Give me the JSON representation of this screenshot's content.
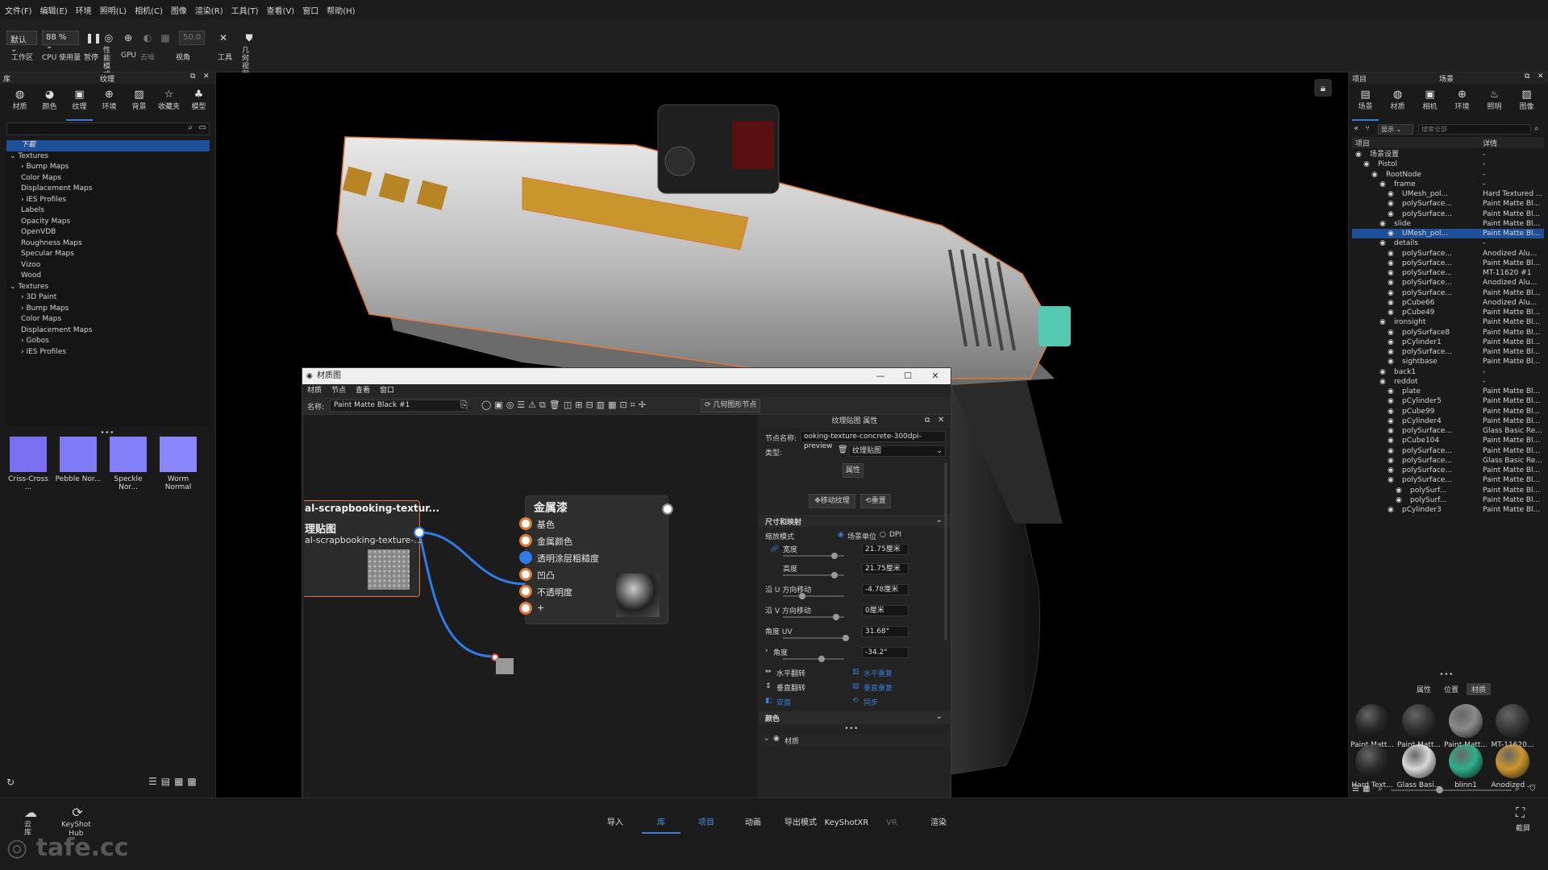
{
  "menu": [
    "文件(F)",
    "编辑(E)",
    "环境",
    "照明(L)",
    "相机(C)",
    "图像",
    "渲染(R)",
    "工具(T)",
    "查看(V)",
    "窗口",
    "帮助(H)"
  ],
  "toolbar": {
    "workspace_value": "默认",
    "workspace_label": "工作区",
    "cpu_value": "88 %",
    "cpu_label": "CPU 使用量",
    "pause_label": "暂停",
    "perf_label": "性能\n模式",
    "gpu_label": "GPU",
    "denoise_label": "去噪",
    "camera_value": "50.0",
    "view_label": "视角",
    "tools_label": "工具",
    "geo_label": "几何\n视图"
  },
  "left": {
    "header_left": "库",
    "header_title": "纹理",
    "tabs": [
      "材质",
      "颜色",
      "纹理",
      "环境",
      "背景",
      "收藏夹",
      "模型"
    ],
    "tree": [
      {
        "label": "下载",
        "depth": 1,
        "sel": true
      },
      {
        "label": "Textures",
        "depth": 0,
        "caret": "⌄"
      },
      {
        "label": "Bump Maps",
        "depth": 1,
        "caret": "›"
      },
      {
        "label": "Color Maps",
        "depth": 1
      },
      {
        "label": "Displacement Maps",
        "depth": 1
      },
      {
        "label": "IES Profiles",
        "depth": 1,
        "caret": "›"
      },
      {
        "label": "Labels",
        "depth": 1
      },
      {
        "label": "Opacity Maps",
        "depth": 1
      },
      {
        "label": "OpenVDB",
        "depth": 1
      },
      {
        "label": "Roughness Maps",
        "depth": 1
      },
      {
        "label": "Specular Maps",
        "depth": 1
      },
      {
        "label": "Vizoo",
        "depth": 1
      },
      {
        "label": "Wood",
        "depth": 1
      },
      {
        "label": "Textures",
        "depth": 0,
        "caret": "⌄"
      },
      {
        "label": "3D Paint",
        "depth": 1,
        "caret": "›"
      },
      {
        "label": "Bump Maps",
        "depth": 1,
        "caret": "›"
      },
      {
        "label": "Color Maps",
        "depth": 1
      },
      {
        "label": "Displacement Maps",
        "depth": 1
      },
      {
        "label": "Gobos",
        "depth": 1,
        "caret": "›"
      },
      {
        "label": "IES Profiles",
        "depth": 1,
        "caret": "›"
      }
    ],
    "thumbs": [
      {
        "label": "Criss-Cross ...",
        "color": "#7a6ff0"
      },
      {
        "label": "Pebble Nor...",
        "color": "#7f7bf6"
      },
      {
        "label": "Speckle Nor...",
        "color": "#8480fa"
      },
      {
        "label": "Worm Normal",
        "color": "#8a86fb"
      }
    ]
  },
  "material_editor": {
    "title": "材质图",
    "menu": [
      "材质",
      "节点",
      "查看",
      "窗口"
    ],
    "name_label": "名称:",
    "name_value": "Paint Matte Black #1",
    "geo_node_btn": "几何图形节点",
    "texture_node_title": "al-scrapbooking-textur...",
    "texture_node_sub": "理贴图",
    "texture_node_file": "al-scrapbooking-texture-...",
    "metal_node_title": "金属漆",
    "metal_inputs": [
      "基色",
      "金属颜色",
      "透明涂层粗糙度",
      "凹凸",
      "不透明度",
      "+"
    ],
    "props": {
      "title": "纹理贴图 属性",
      "node_name_label": "节点名称:",
      "node_name_value": "ooking-texture-concrete-300dpi-preview",
      "type_label": "类型:",
      "type_value": "纹理贴图",
      "tab_props": "属性",
      "move_texture": "移动纹理",
      "reset": "重置",
      "section_size": "尺寸和映射",
      "scale_mode_label": "缩放模式",
      "scale_mode_scene": "场景单位",
      "scale_mode_dpi": "DPI",
      "width_label": "宽度",
      "width_value": "21.75厘米",
      "height_label": "高度",
      "height_value": "21.75厘米",
      "u_move_label": "沿 U 方向移动",
      "u_move_value": "-4.78厘米",
      "v_move_label": "沿 V 方向移动",
      "v_move_value": "0厘米",
      "angle_uv_label": "角度 UV",
      "angle_uv_value": "31.68°",
      "angle_label": "角度",
      "angle_value": "-34.2°",
      "flip_h_label": "水平翻转",
      "repeat_h_label": "水平重复",
      "flip_v_label": "垂直翻转",
      "repeat_v_label": "垂直重复",
      "mirror_label": "双面",
      "sync_label": "同步",
      "section_color": "颜色",
      "section_material": "材质"
    }
  },
  "right": {
    "header_left": "项目",
    "header_title": "场景",
    "tabs": [
      "场景",
      "材质",
      "相机",
      "环境",
      "照明",
      "图像"
    ],
    "show_value": "显示",
    "search_placeholder": "搜索全部",
    "col_item": "项目",
    "col_detail": "详情",
    "tree": [
      {
        "name": "场景设置",
        "detail": "-",
        "indent": 0
      },
      {
        "name": "Pistol",
        "detail": "-",
        "indent": 1
      },
      {
        "name": "RootNode",
        "detail": "-",
        "indent": 2
      },
      {
        "name": "frame",
        "detail": "-",
        "indent": 3
      },
      {
        "name": "UMesh_pol...",
        "detail": "Hard Textured ...",
        "indent": 4
      },
      {
        "name": "polySurface...",
        "detail": "Paint Matte Bl...",
        "indent": 4
      },
      {
        "name": "polySurface...",
        "detail": "Paint Matte Bl...",
        "indent": 4
      },
      {
        "name": "slide",
        "detail": "Paint Matte Bl...",
        "indent": 3
      },
      {
        "name": "UMesh_pol...",
        "detail": "Paint Matte Bl...",
        "indent": 4,
        "sel": true
      },
      {
        "name": "details",
        "detail": "-",
        "indent": 3
      },
      {
        "name": "polySurface...",
        "detail": "Anodized Alu...",
        "indent": 4
      },
      {
        "name": "polySurface...",
        "detail": "Paint Matte Bl...",
        "indent": 4
      },
      {
        "name": "polySurface...",
        "detail": "MT-11620 #1",
        "indent": 4
      },
      {
        "name": "polySurface...",
        "detail": "Anodized Alu...",
        "indent": 4
      },
      {
        "name": "polySurface...",
        "detail": "Paint Matte Bl...",
        "indent": 4
      },
      {
        "name": "pCube66",
        "detail": "Anodized Alu...",
        "indent": 4
      },
      {
        "name": "pCube49",
        "detail": "Paint Matte Bl...",
        "indent": 4
      },
      {
        "name": "ironsight",
        "detail": "Paint Matte Bl...",
        "indent": 3
      },
      {
        "name": "polySurface8",
        "detail": "Paint Matte Bl...",
        "indent": 4
      },
      {
        "name": "pCylinder1",
        "detail": "Paint Matte Bl...",
        "indent": 4
      },
      {
        "name": "polySurface...",
        "detail": "Paint Matte Bl...",
        "indent": 4
      },
      {
        "name": "sightbase",
        "detail": "Paint Matte Bl...",
        "indent": 4
      },
      {
        "name": "back1",
        "detail": "-",
        "indent": 3
      },
      {
        "name": "reddot",
        "detail": "-",
        "indent": 3
      },
      {
        "name": "plate",
        "detail": "Paint Matte Bl...",
        "indent": 4
      },
      {
        "name": "pCylinder5",
        "detail": "Paint Matte Bl...",
        "indent": 4
      },
      {
        "name": "pCube99",
        "detail": "Paint Matte Bl...",
        "indent": 4
      },
      {
        "name": "pCylinder4",
        "detail": "Paint Matte Bl...",
        "indent": 4
      },
      {
        "name": "polySurface...",
        "detail": "Glass Basic Re...",
        "indent": 4
      },
      {
        "name": "pCube104",
        "detail": "Paint Matte Bl...",
        "indent": 4
      },
      {
        "name": "polySurface...",
        "detail": "Paint Matte Bl...",
        "indent": 4
      },
      {
        "name": "polySurface...",
        "detail": "Glass Basic Re...",
        "indent": 4
      },
      {
        "name": "polySurface...",
        "detail": "Paint Matte Bl...",
        "indent": 4
      },
      {
        "name": "polySurface...",
        "detail": "Paint Matte Bl...",
        "indent": 4
      },
      {
        "name": "polySurf...",
        "detail": "Paint Matte Bl...",
        "indent": 5
      },
      {
        "name": "polySurf...",
        "detail": "Paint Matte Bl...",
        "indent": 5
      },
      {
        "name": "pCylinder3",
        "detail": "Paint Matte Bl...",
        "indent": 4
      }
    ],
    "sub_tabs": [
      "属性",
      "位置",
      "材质"
    ],
    "materials": [
      {
        "label": "Paint Matt...",
        "color": "#2a2a2a"
      },
      {
        "label": "Paint Matt...",
        "color": "#333333"
      },
      {
        "label": "Paint Matt...",
        "color": "#8a8a8a"
      },
      {
        "label": "MT-11620...",
        "color": "#3a3a3a"
      },
      {
        "label": "Hard Text...",
        "color": "#2c2c2c"
      },
      {
        "label": "Glass Basi...",
        "color": "#d9d9d9"
      },
      {
        "label": "blinn1",
        "color": "#2fae8a"
      },
      {
        "label": "Anodized ...",
        "color": "#c9962e"
      }
    ]
  },
  "bottom": {
    "cloud_label": "云\n库",
    "hub_label": "KeyShot\nHub",
    "tabs": [
      "导入",
      "库",
      "项目",
      "动画",
      "导出模式",
      "KeyShotXR",
      "VR",
      "渲染"
    ],
    "active_tab": "库",
    "screenshot_label": "截屏",
    "watermark": "tafe.cc"
  },
  "colors": {
    "accent": "#3a7bd5",
    "selection": "#1f4f96",
    "node_orange": "#e07a3a",
    "wire_blue": "#2f7be8"
  }
}
